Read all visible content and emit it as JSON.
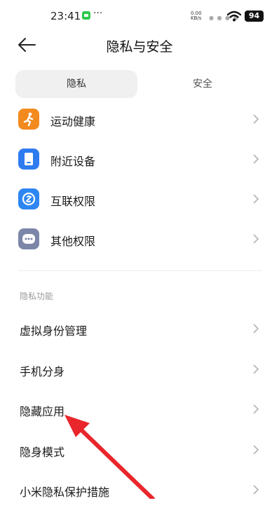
{
  "status_bar": {
    "time": "23:41",
    "more": "···",
    "net_speed_value": "0.00",
    "net_speed_unit": "KB/s",
    "battery": "94"
  },
  "header": {
    "title": "隐私与安全"
  },
  "tabs": [
    {
      "label": "隐私",
      "active": true
    },
    {
      "label": "安全",
      "active": false
    }
  ],
  "icon_items": [
    {
      "label": "运动健康",
      "icon": "running-person-icon",
      "color": "#f28a1e"
    },
    {
      "label": "附近设备",
      "icon": "device-icon",
      "color": "#2f7bf0"
    },
    {
      "label": "互联权限",
      "icon": "link-icon",
      "color": "#2e86f2"
    },
    {
      "label": "其他权限",
      "icon": "more-icon",
      "color": "#7b86a8"
    }
  ],
  "section": {
    "title": "隐私功能",
    "items": [
      {
        "label": "虚拟身份管理"
      },
      {
        "label": "手机分身"
      },
      {
        "label": "隐藏应用"
      },
      {
        "label": "隐身模式"
      },
      {
        "label": "小米隐私保护措施"
      }
    ]
  },
  "annotation": {
    "arrow_color": "#e8262b"
  }
}
